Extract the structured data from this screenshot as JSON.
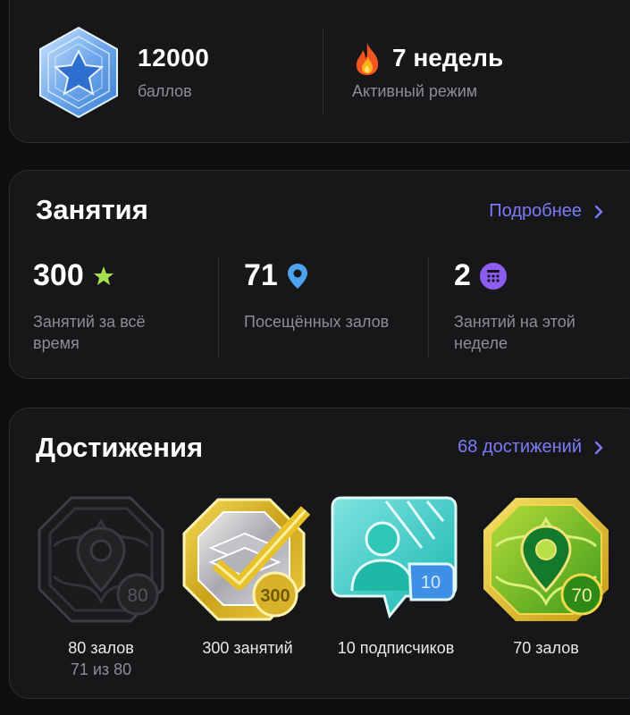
{
  "summary": {
    "points_value": "12000",
    "points_label": "баллов",
    "streak_value": "7 недель",
    "streak_label": "Активный режим"
  },
  "classes": {
    "title": "Занятия",
    "more_link": "Подробнее",
    "stats": [
      {
        "value": "300",
        "label": "Занятий за всё время",
        "icon": "star-icon",
        "icon_color": "#a4e04b"
      },
      {
        "value": "71",
        "label": "Посещённых залов",
        "icon": "location-pin-icon",
        "icon_color": "#4da3f0"
      },
      {
        "value": "2",
        "label": "Занятий на этой неделе",
        "icon": "calendar-icon",
        "icon_color": "#8c5cf0"
      }
    ]
  },
  "achievements": {
    "title": "Достижения",
    "count_link": "68 достижений",
    "items": [
      {
        "name": "80 залов",
        "progress": "71 из 80",
        "badge_number": "80",
        "state": "locked"
      },
      {
        "name": "300 занятий",
        "progress": "",
        "badge_number": "300",
        "state": "unlocked"
      },
      {
        "name": "10 подписчиков",
        "progress": "",
        "badge_number": "10",
        "state": "unlocked"
      },
      {
        "name": "70 залов",
        "progress": "",
        "badge_number": "70",
        "state": "unlocked"
      }
    ]
  },
  "colors": {
    "background": "#0f0f11",
    "card": "#17171a",
    "accent_link": "#7b7cf5",
    "muted_text": "#8d8d93"
  }
}
